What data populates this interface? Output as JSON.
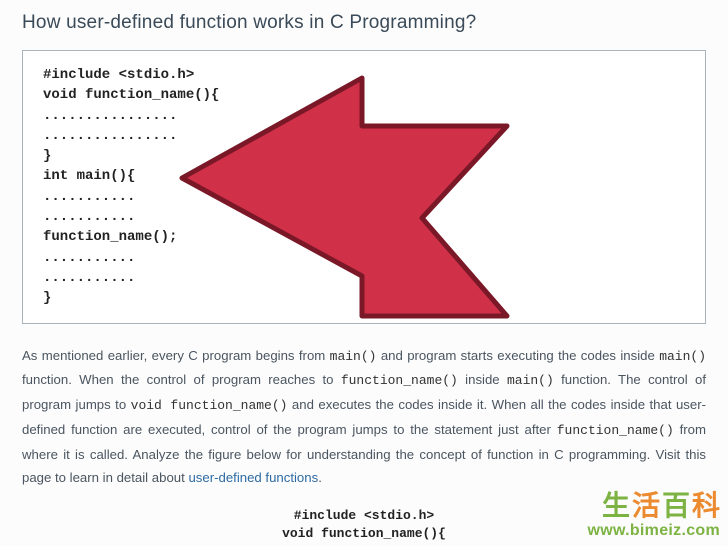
{
  "title": "How user-defined function works in C Programming?",
  "code": {
    "l0": "#include <stdio.h>",
    "l1": "void function_name(){",
    "l2": "................",
    "l3": "................",
    "l4": "}",
    "l5": "int main(){",
    "l6": "...........",
    "l7": "...........",
    "l8": "function_name();",
    "l9": "...........",
    "l10": "...........",
    "l11": "}"
  },
  "prose": {
    "p1a": "As mentioned earlier, every C program begins from ",
    "main1": "main()",
    "p1b": " and program starts executing the codes inside ",
    "main2": "main()",
    "p1c": " function. When the control of program reaches to ",
    "fn1": "function_name()",
    "p1d": " inside ",
    "main3": "main()",
    "p1e": " function. The control of program jumps to ",
    "voidfn": "void  function_name()",
    "p1f": " and executes the codes inside it. When all the codes inside that user-defined function are executed, control of the program jumps to the statement just after ",
    "fn2": "function_name()",
    "p1g": " from where it is called. Analyze the figure below for understanding the concept of function in C programming. Visit this page to learn in detail about ",
    "link": "user-defined functions",
    "p1h": "."
  },
  "bottom": {
    "l0": "#include <stdio.h>",
    "l1": "void function_name(){"
  },
  "watermark": {
    "c0": "生",
    "c1": "活",
    "c2": "百",
    "c3": "科",
    "url": "www.bimeiz.com"
  },
  "icons": {
    "arrow": "red-pointer-arrow"
  }
}
